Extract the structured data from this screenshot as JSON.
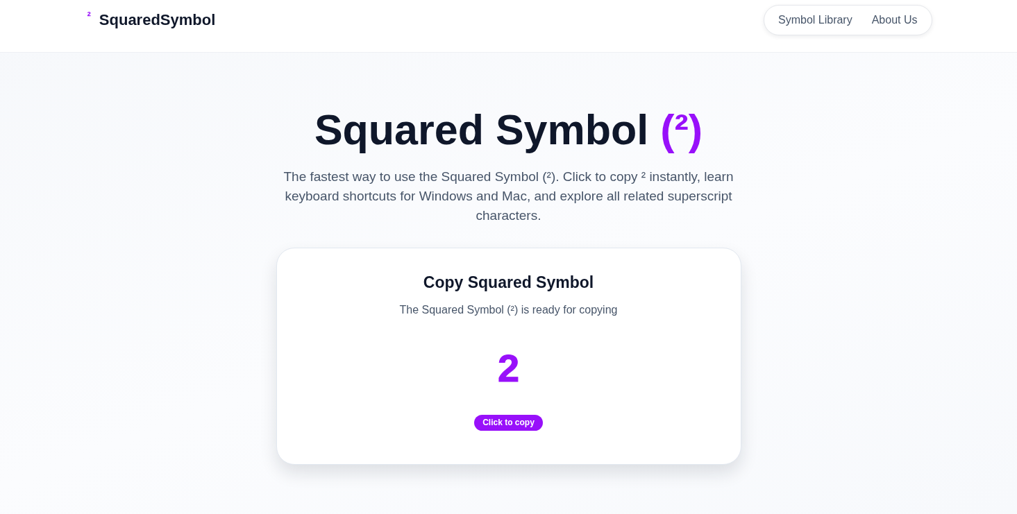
{
  "header": {
    "logo": {
      "mark": "²",
      "name": "SquaredSymbol"
    },
    "nav": [
      "Symbol Library",
      "About Us"
    ]
  },
  "hero": {
    "title": {
      "text": "Squared Symbol",
      "accent": "(²)"
    },
    "description": "The fastest way to use the Squared Symbol (²). Click to copy ² instantly, learn keyboard shortcuts for Windows and Mac, and explore all related superscript characters."
  },
  "copy_card": {
    "title": "Copy Squared Symbol",
    "subtitle": "The Squared Symbol (²) is ready for copying",
    "symbol": "2",
    "button": "Click to copy"
  }
}
